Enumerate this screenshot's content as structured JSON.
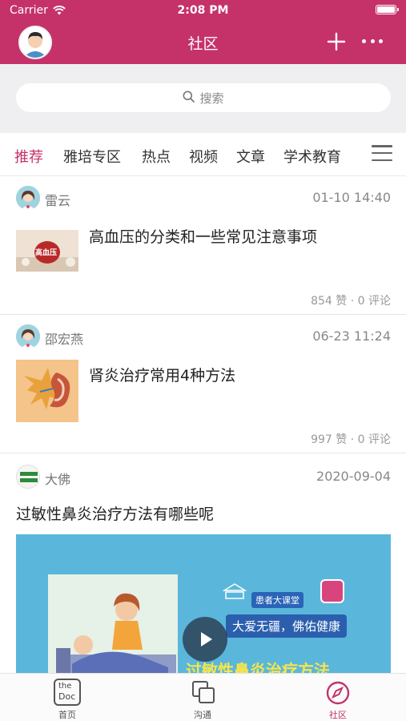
{
  "status_bar": {
    "carrier": "Carrier",
    "time": "2:08 PM"
  },
  "nav": {
    "title": "社区"
  },
  "search": {
    "placeholder": "搜索"
  },
  "tabs": [
    {
      "label": "推荐",
      "active": true
    },
    {
      "label": "雅培专区",
      "active": false
    },
    {
      "label": "热点",
      "active": false
    },
    {
      "label": "视频",
      "active": false
    },
    {
      "label": "文章",
      "active": false
    },
    {
      "label": "学术教育",
      "active": false
    }
  ],
  "posts": [
    {
      "author": "雷云",
      "date": "01-10 14:40",
      "title": "高血压的分类和一些常见注意事项",
      "stats": "854 赞 · 0 评论",
      "thumb_text": "高血压"
    },
    {
      "author": "邵宏燕",
      "date": "06-23 11:24",
      "title": "肾炎治疗常用4种方法",
      "stats": "997 赞 · 0 评论"
    },
    {
      "author": "大佛",
      "date": "2020-09-04",
      "title": "过敏性鼻炎治疗方法有哪些呢",
      "video": {
        "badge": "患者大课堂",
        "slogan": "大爱无疆，佛佑健康",
        "caption": "过敏性鼻炎治疗方法"
      }
    }
  ],
  "tabbar": [
    {
      "label": "首页",
      "icon_text_1": "the",
      "icon_text_2": "Doc",
      "active": false
    },
    {
      "label": "沟通",
      "active": false
    },
    {
      "label": "社区",
      "active": true
    }
  ],
  "colors": {
    "brand": "#c5326a",
    "video_bg": "#5ab7db"
  }
}
